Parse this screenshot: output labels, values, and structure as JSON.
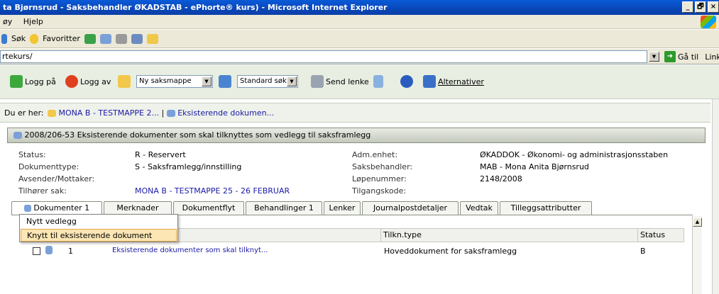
{
  "window": {
    "title": "ta Bjørnsrud - Saksbehandler ØKADSTAB - ePhorte® kurs) - Microsoft Internet Explorer",
    "buttons": [
      "_",
      "🗗",
      "×"
    ]
  },
  "menu": [
    "øy",
    "Hjelp"
  ],
  "ie_toolbar": {
    "search": "Søk",
    "favorites": "Favoritter"
  },
  "address": {
    "value": "rtekurs/",
    "go": "Gå til",
    "links": "Links"
  },
  "app_toolbar": {
    "login": "Logg på",
    "logout": "Logg av",
    "folder_select": "Ny saksmappe",
    "search_select": "Standard søk",
    "send_link": "Send lenke",
    "alternatives": "Alternativer"
  },
  "breadcrumb": {
    "prefix": "Du er her:",
    "item1": "MONA B - TESTMAPPE 2...",
    "separator": "|",
    "item2": "Eksisterende dokumen..."
  },
  "record": {
    "header": "2008/206-53  Eksisterende dokumenter som skal tilknyttes som vedlegg til saksframlegg",
    "fields_left": [
      {
        "label": "Status:",
        "value": "R - Reservert"
      },
      {
        "label": "Dokumenttype:",
        "value": "S - Saksframlegg/innstilling"
      },
      {
        "label": "Avsender/Mottaker:",
        "value": ""
      },
      {
        "label": "Tilhører sak:",
        "value": "MONA B - TESTMAPPE 25 - 26 FEBRUAR"
      }
    ],
    "fields_right": [
      {
        "label": "Adm.enhet:",
        "value": "ØKADDOK - Økonomi- og administrasjonsstaben"
      },
      {
        "label": "Saksbehandler:",
        "value": "MAB - Mona Anita Bjørnsrud"
      },
      {
        "label": "Løpenummer:",
        "value": "2148/2008"
      },
      {
        "label": "Tilgangskode:",
        "value": ""
      }
    ]
  },
  "tabs": [
    {
      "label": "Dokumenter",
      "count": "1"
    },
    {
      "label": "Merknader",
      "count": ""
    },
    {
      "label": "Dokumentflyt",
      "count": ""
    },
    {
      "label": "Behandlinger",
      "count": "1"
    },
    {
      "label": "Lenker",
      "count": ""
    },
    {
      "label": "Journalpostdetaljer",
      "count": ""
    },
    {
      "label": "Vedtak",
      "count": ""
    },
    {
      "label": "Tilleggsattributter",
      "count": ""
    }
  ],
  "grid": {
    "headers": [
      "Tilkn.type",
      "Status"
    ],
    "rows": [
      {
        "num": "1",
        "title": "Eksisterende dokumenter som skal tilknyt...",
        "type": "Hoveddokument for saksframlegg",
        "status": "B"
      }
    ]
  },
  "popup_menu": [
    "Nytt vedlegg",
    "Knytt til eksisterende dokument"
  ],
  "colors": {
    "accent": "#0a46b8",
    "link": "#1a1aa6",
    "highlight": "#fbe6b4",
    "app_bg": "#e8eee2"
  }
}
